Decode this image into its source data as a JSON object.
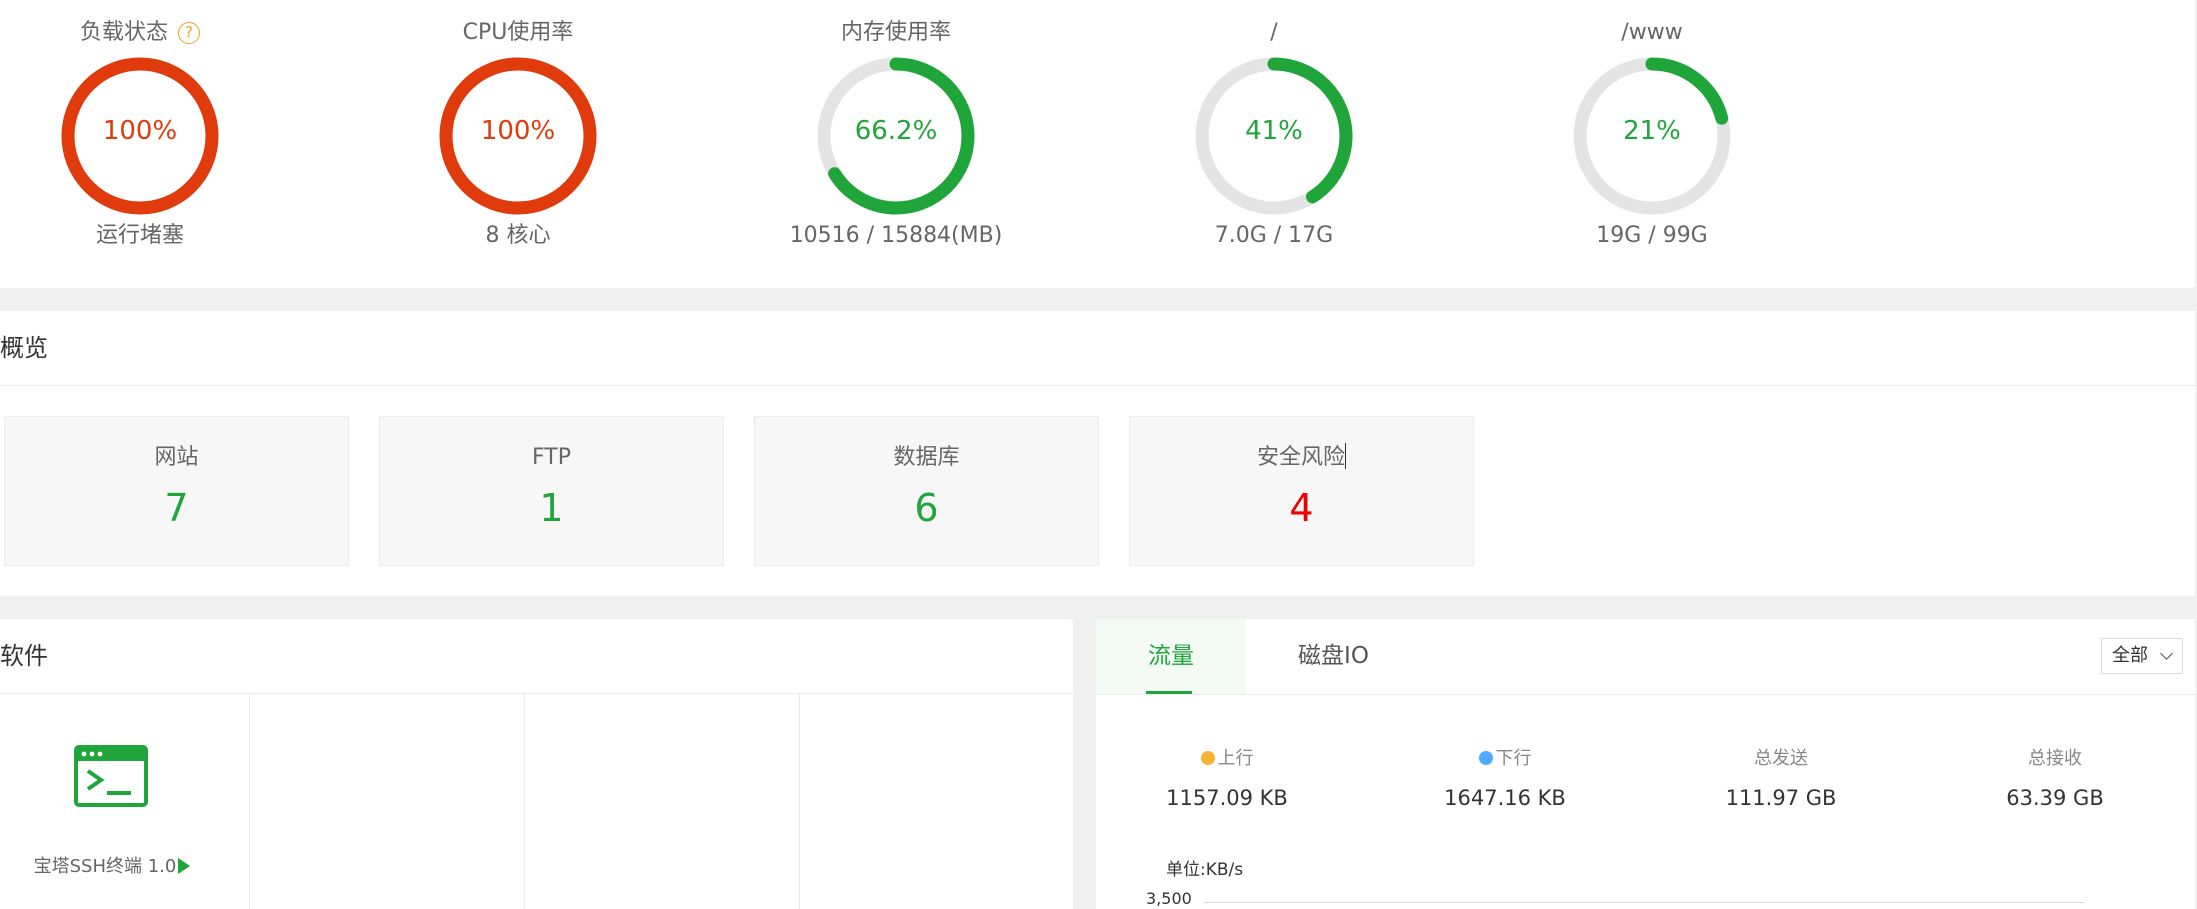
{
  "status": {
    "load": {
      "title": "负载状态",
      "help_icon": "?",
      "value": "100%",
      "percent": 100,
      "sub": "运行堵塞",
      "color": "#e03b0c"
    },
    "cpu": {
      "title": "CPU使用率",
      "value": "100%",
      "percent": 100,
      "sub": "8 核心",
      "color": "#e03b0c"
    },
    "memory": {
      "title": "内存使用率",
      "value": "66.2%",
      "percent": 66.2,
      "sub": "10516 / 15884(MB)",
      "color": "#20a53a"
    },
    "disk_root": {
      "title": "/",
      "value": "41%",
      "percent": 41,
      "sub": "7.0G / 17G",
      "color": "#20a53a"
    },
    "disk_www": {
      "title": "/www",
      "value": "21%",
      "percent": 21,
      "sub": "19G / 99G",
      "color": "#20a53a"
    }
  },
  "overview": {
    "title": "概览",
    "cards": [
      {
        "label": "网站",
        "count": "7",
        "color": "#20a53a"
      },
      {
        "label": "FTP",
        "count": "1",
        "color": "#20a53a"
      },
      {
        "label": "数据库",
        "count": "6",
        "color": "#20a53a"
      },
      {
        "label": "安全风险",
        "count": "4",
        "color": "#f00000"
      }
    ]
  },
  "software": {
    "title": "软件",
    "items": [
      {
        "name": "宝塔SSH终端 1.0",
        "icon": "terminal-icon"
      }
    ]
  },
  "traffic": {
    "tabs": {
      "flow": "流量",
      "disk_io": "磁盘IO"
    },
    "scope": "全部",
    "stats": {
      "up": {
        "label": "上行",
        "value": "1157.09 KB",
        "dot_color": "#f7b338"
      },
      "down": {
        "label": "下行",
        "value": "1647.16 KB",
        "dot_color": "#52a9ff"
      },
      "sent": {
        "label": "总发送",
        "value": "111.97 GB"
      },
      "received": {
        "label": "总接收",
        "value": "63.39 GB"
      }
    },
    "unit": "单位:KB/s",
    "y_tick_top": "3,500"
  },
  "colors": {
    "accent": "#20a53a",
    "danger": "#e03b0c",
    "track": "#e4e4e4"
  }
}
